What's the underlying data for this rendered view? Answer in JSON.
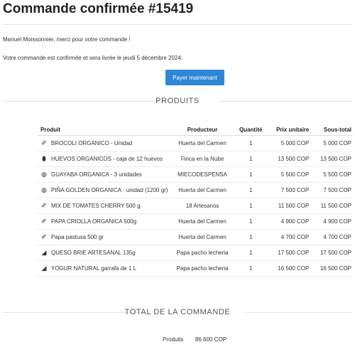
{
  "header": {
    "title": "Commande confirmée #15419"
  },
  "messages": {
    "greeting": "Manuel Moissonnier, merci pour votre commande !",
    "confirmation": "Votre commande est confirmée et sera livrée le jeudi 5 décembre 2024."
  },
  "pay_button": {
    "label": "Payer maintenant"
  },
  "products_section": {
    "title": "PRODUITS",
    "columns": [
      "Produit",
      "Producteur",
      "Quantité",
      "Prix unitaire",
      "Sous-total"
    ],
    "rows": [
      {
        "icon": "carrot-icon",
        "name": "BROCOLI ORGANICO - Unidad",
        "producer": "Huerta del Carmen",
        "qty": "1",
        "unit": "5 000 COP",
        "subtotal": "5 000 COP"
      },
      {
        "icon": "egg-icon",
        "name": "HUEVOS ORGANICOS - caja de 12 huevos",
        "producer": "Finca en la Nube",
        "qty": "1",
        "unit": "13 500 COP",
        "subtotal": "13 500 COP"
      },
      {
        "icon": "fruit-icon",
        "name": "GUAYABA ORGANICA - 3 unidades",
        "producer": "MIECODESPENSA",
        "qty": "1",
        "unit": "5 500 COP",
        "subtotal": "5 500 COP"
      },
      {
        "icon": "fruit-icon",
        "name": "PIÑA GOLDEN ORGANICA - unidad (1200 gr)",
        "producer": "Huerta del Carmen",
        "qty": "1",
        "unit": "7 500 COP",
        "subtotal": "7 500 COP"
      },
      {
        "icon": "carrot-icon",
        "name": "MIX DE TOMATES CHERRY 500 g",
        "producer": "18 Artesanos",
        "qty": "1",
        "unit": "11 500 COP",
        "subtotal": "11 500 COP"
      },
      {
        "icon": "carrot-icon",
        "name": "PAPA CRIOLLA ORGANICA 500g",
        "producer": "Huerta del Carmen",
        "qty": "1",
        "unit": "4 900 COP",
        "subtotal": "4 900 COP"
      },
      {
        "icon": "carrot-icon",
        "name": "Papa pastusa 500 gr",
        "producer": "Huerta del Carmen",
        "qty": "1",
        "unit": "4 700 COP",
        "subtotal": "4 700 COP"
      },
      {
        "icon": "cheese-icon",
        "name": "QUESO BRIE ARTESANAL 135g",
        "producer": "Papa pacho lecheria",
        "qty": "1",
        "unit": "17 500 COP",
        "subtotal": "17 500 COP"
      },
      {
        "icon": "cheese-icon",
        "name": "YOGUR NATURAL garrafa de 1 L",
        "producer": "Papa pacho lecheria",
        "qty": "1",
        "unit": "16 500 COP",
        "subtotal": "16 500 COP"
      }
    ]
  },
  "icons": {
    "carrot-icon": "✐",
    "egg-icon": "⬮",
    "fruit-icon": "◍",
    "cheese-icon": "◢"
  },
  "total_section": {
    "title": "TOTAL DE LA COMMANDE",
    "products_label": "Produits",
    "products_value": "86 600 COP"
  },
  "colors": {
    "accent": "#2d86d6",
    "text": "#333333",
    "divider": "#e4e4e4"
  }
}
